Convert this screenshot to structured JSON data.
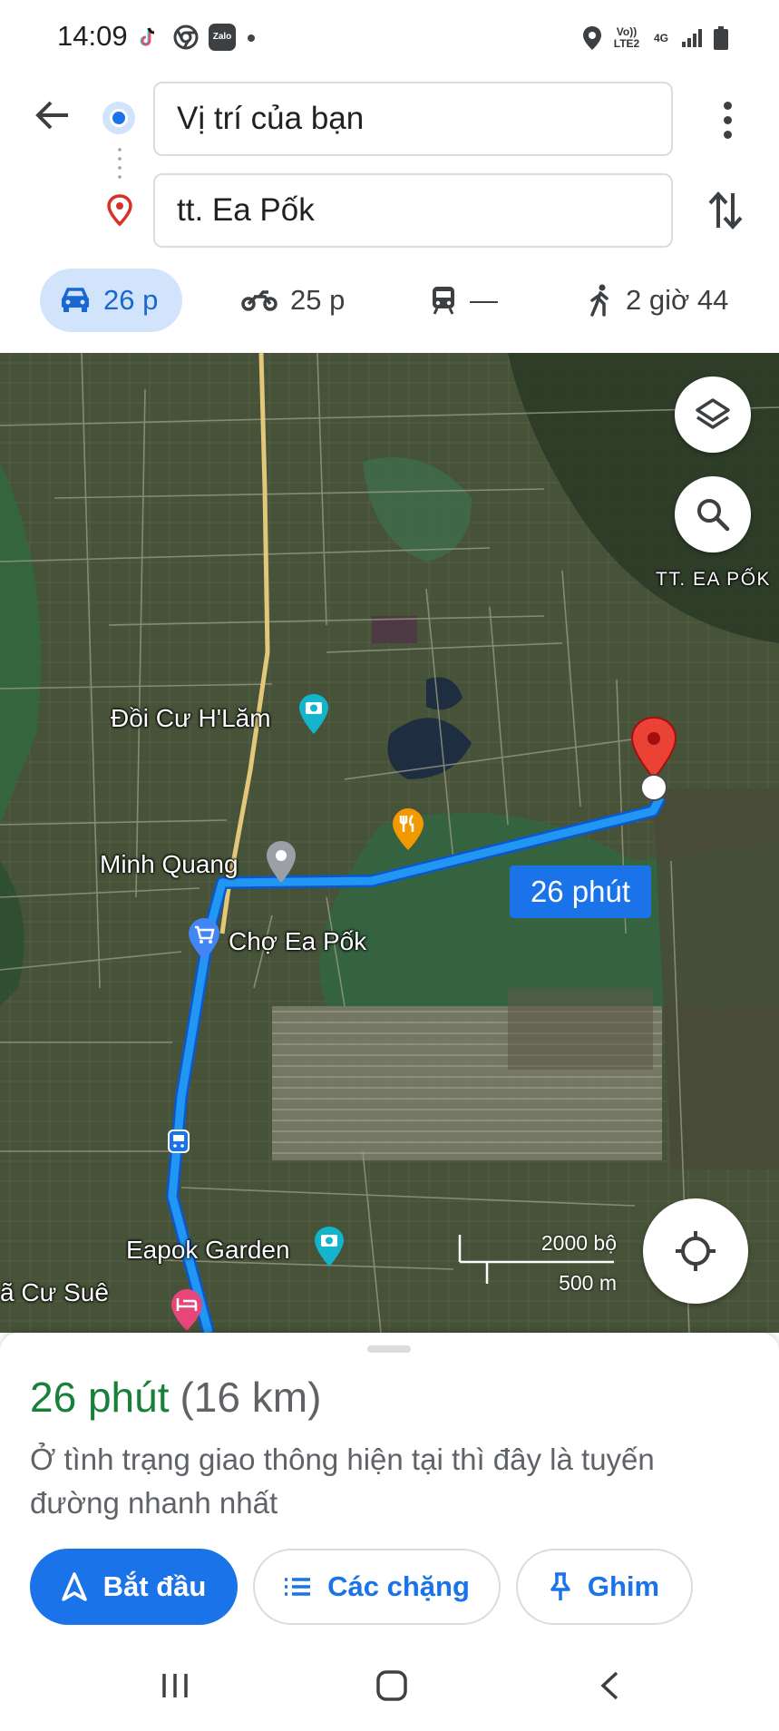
{
  "status_bar": {
    "time": "14:09",
    "network_top": "Vo)) LTE2",
    "network_4g": "4G",
    "apps": [
      "tiktok-icon",
      "chrome-icon",
      "zalo-icon"
    ],
    "zalo_label": "Zalo"
  },
  "directions": {
    "origin": "Vị trí của bạn",
    "destination": "tt. Ea Pốk",
    "modes": [
      {
        "name": "drive",
        "label": "26 p",
        "active": true
      },
      {
        "name": "motorbike",
        "label": "25 p"
      },
      {
        "name": "transit",
        "label": "—"
      },
      {
        "name": "walk",
        "label": "2 giờ 44"
      }
    ]
  },
  "map": {
    "area_label": "TT. EA PỐK",
    "places": [
      "Đồi Cư H'Lăm",
      "Minh Quang",
      "Chợ Ea Pốk",
      "Eapok Garden",
      "ã Cư Suê"
    ],
    "route_label": "26 phút",
    "scale": {
      "imperial": "2000 bộ",
      "metric": "500 m"
    }
  },
  "trip": {
    "duration": "26 phút",
    "distance": "(16 km)",
    "note": "Ở tình trạng giao thông hiện tại thì đây là tuyến đường nhanh nhất"
  },
  "actions": {
    "start": "Bắt đầu",
    "steps": "Các chặng",
    "pin": "Ghim"
  },
  "colors": {
    "accent": "#1a73e8",
    "route": "#2196f3",
    "time_green": "#188038"
  }
}
